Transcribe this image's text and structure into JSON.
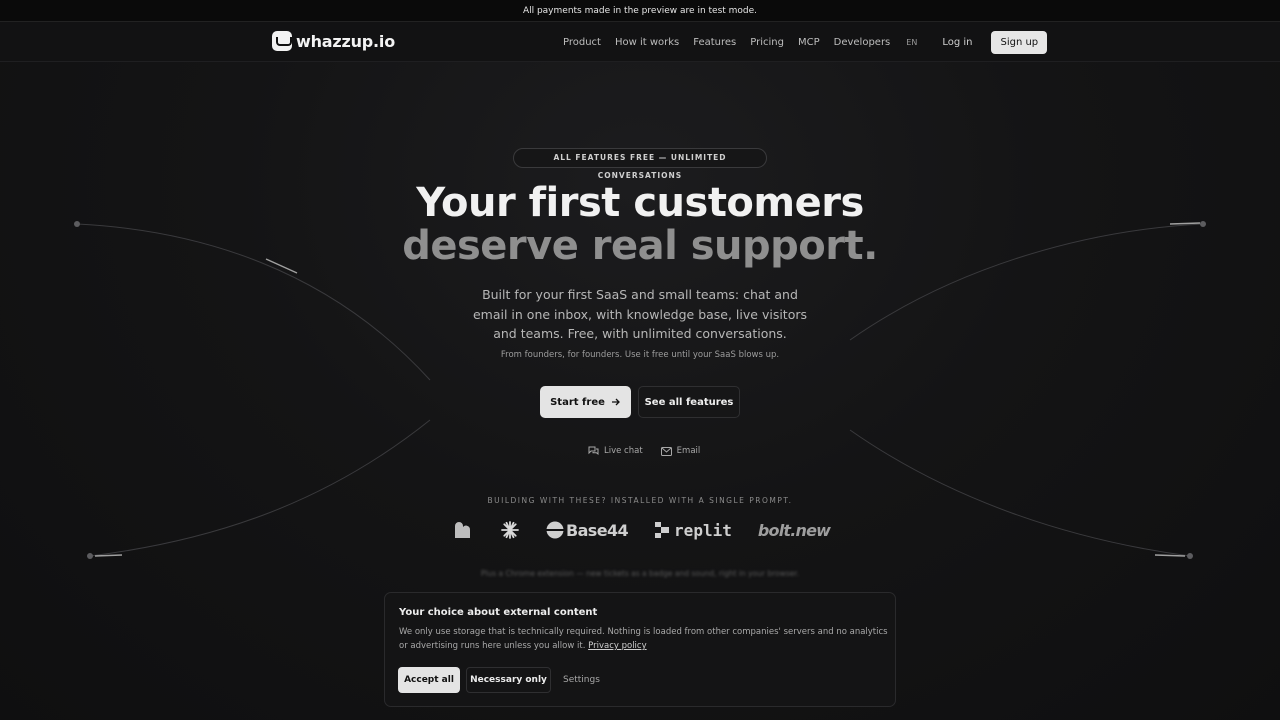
{
  "test_banner": "All payments made in the preview are in test mode.",
  "brand": {
    "name": "whazzup.io"
  },
  "nav": {
    "links": [
      "Product",
      "How it works",
      "Features",
      "Pricing",
      "MCP",
      "Developers"
    ],
    "lang": "EN",
    "login": "Log in",
    "signup": "Sign up"
  },
  "hero": {
    "pill": "ALL FEATURES FREE — UNLIMITED CONVERSATIONS",
    "title_line1": "Your first customers",
    "title_line2": "deserve real support.",
    "subtitle": "Built for your first SaaS and small teams: chat and email in one inbox, with knowledge base, live visitors and teams. Free, with unlimited conversations.",
    "note": "From founders, for founders. Use it free until your SaaS blows up.",
    "cta_primary": "Start free",
    "cta_secondary": "See all features",
    "channels": [
      {
        "icon": "chat-bubbles-icon",
        "label": "Live chat"
      },
      {
        "icon": "envelope-icon",
        "label": "Email"
      }
    ]
  },
  "builders": {
    "label": "BUILDING WITH THESE? INSTALLED WITH A SINGLE PROMPT.",
    "logos": [
      "lovable-logo",
      "claude-logo",
      "Base44",
      "replit",
      "bolt.new"
    ]
  },
  "chrome_note": "Plus a Chrome extension — new tickets as a badge and sound, right in your browser.",
  "cookie": {
    "title": "Your choice about external content",
    "text": "We only use storage that is technically required. Nothing is loaded from other companies' servers and no analytics or advertising runs here unless you allow it.",
    "link": "Privacy policy",
    "accept": "Accept all",
    "necessary": "Necessary only",
    "settings": "Settings"
  },
  "colors": {
    "background": "#111112",
    "primary_button": "#e4e4e4",
    "text": "#f1f1f1",
    "muted": "#8f8f8f"
  }
}
